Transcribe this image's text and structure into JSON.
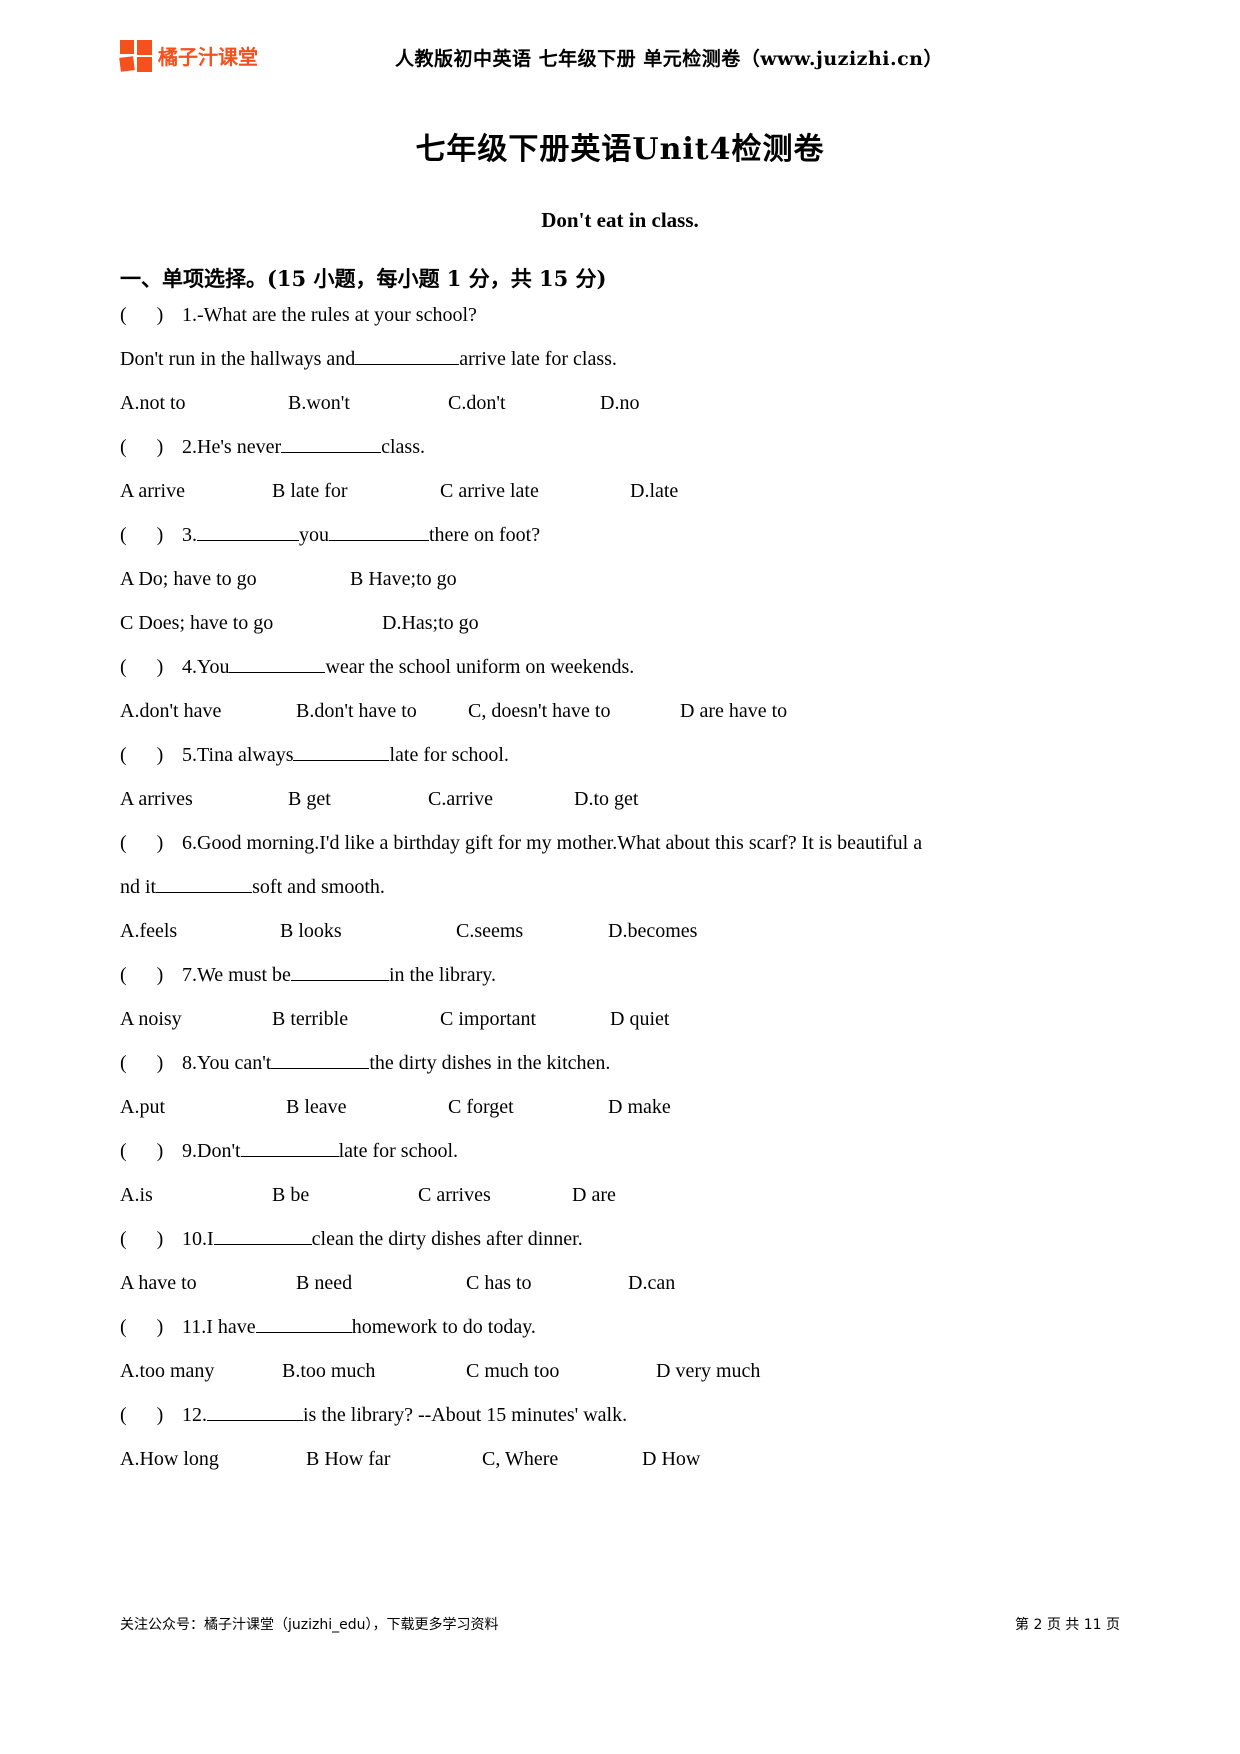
{
  "header": {
    "logo_text": "橘子汁课堂",
    "logo_color": "#f4511e",
    "title": "人教版初中英语 七年级下册 单元检测卷（www.juzizhi.cn）"
  },
  "document": {
    "title": "七年级下册英语Unit4检测卷",
    "subtitle": "Don't eat in class.",
    "section_heading": "一、单项选择。(15 小题，每小题 1 分，共 15 分)"
  },
  "questions": [
    {
      "prefix": "(",
      "close": ")",
      "number": "1.",
      "stem": "-What are the rules at your school?",
      "stem2_pre": "Don't run in the hallways and",
      "stem2_post": "arrive late for class.",
      "options": [
        "A.not to",
        "B.won't",
        "C.don't",
        "D.no"
      ]
    },
    {
      "number": "2.",
      "stem_pre": "He's never",
      "stem_post": "class.",
      "options": [
        "A arrive",
        "B late for",
        "C arrive late",
        "D.late"
      ]
    },
    {
      "number": "3.",
      "stem_pre": "",
      "stem_mid": "you",
      "stem_post": "there on foot?",
      "options_row1": [
        "A Do; have to go",
        "B Have;to go"
      ],
      "options_row2": [
        "C Does; have to go",
        "D.Has;to go"
      ]
    },
    {
      "number": "4.",
      "stem_pre": "You",
      "stem_post": "wear the school uniform on weekends.",
      "options": [
        "A.don't have",
        "B.don't have to",
        "C, doesn't have to",
        "D are have to"
      ]
    },
    {
      "number": "5.",
      "stem_pre": "Tina always",
      "stem_post": "late for school.",
      "options": [
        "A arrives",
        "B get",
        "C.arrive",
        "D.to get"
      ]
    },
    {
      "number": "6.",
      "stem_line1": "Good morning.I'd like a birthday gift for my mother.What about this scarf? It is beautiful a",
      "stem_line2_pre": "nd it",
      "stem_line2_post": "soft and smooth.",
      "options": [
        "A.feels",
        "B looks",
        "C.seems",
        "D.becomes"
      ]
    },
    {
      "number": "7.",
      "stem_pre": "We must be",
      "stem_post": "in the library.",
      "options": [
        "A noisy",
        "B terrible",
        "C important",
        "D quiet"
      ]
    },
    {
      "number": "8.",
      "stem_pre": "You can't",
      "stem_post": "the dirty dishes in the kitchen.",
      "options": [
        "A.put",
        "B leave",
        "C forget",
        "D make"
      ]
    },
    {
      "number": "9.",
      "stem_pre": "Don't",
      "stem_post": "late for school.",
      "options": [
        "A.is",
        "B be",
        "C arrives",
        "D are"
      ]
    },
    {
      "number": "10.",
      "stem_pre": "I",
      "stem_post": "clean the dirty dishes after dinner.",
      "options": [
        "A have to",
        "B need",
        "C has to",
        "D.can"
      ]
    },
    {
      "number": "11.",
      "stem_pre": "I have",
      "stem_post": "homework to do today.",
      "options": [
        "A.too many",
        "B.too much",
        "C much too",
        "D very much"
      ]
    },
    {
      "number": "12.",
      "stem_pre": "",
      "stem_post": "is the library?    --About 15 minutes' walk.",
      "options": [
        "A.How long",
        "B How far",
        "C, Where",
        "D How"
      ]
    }
  ],
  "footer": {
    "left": "关注公众号：橘子汁课堂（juzizhi_edu），下载更多学习资料",
    "page_label_1": "第",
    "page_number": "2",
    "page_label_2": "页",
    "page_label_3": "共",
    "page_total": "11",
    "page_label_4": "页"
  }
}
